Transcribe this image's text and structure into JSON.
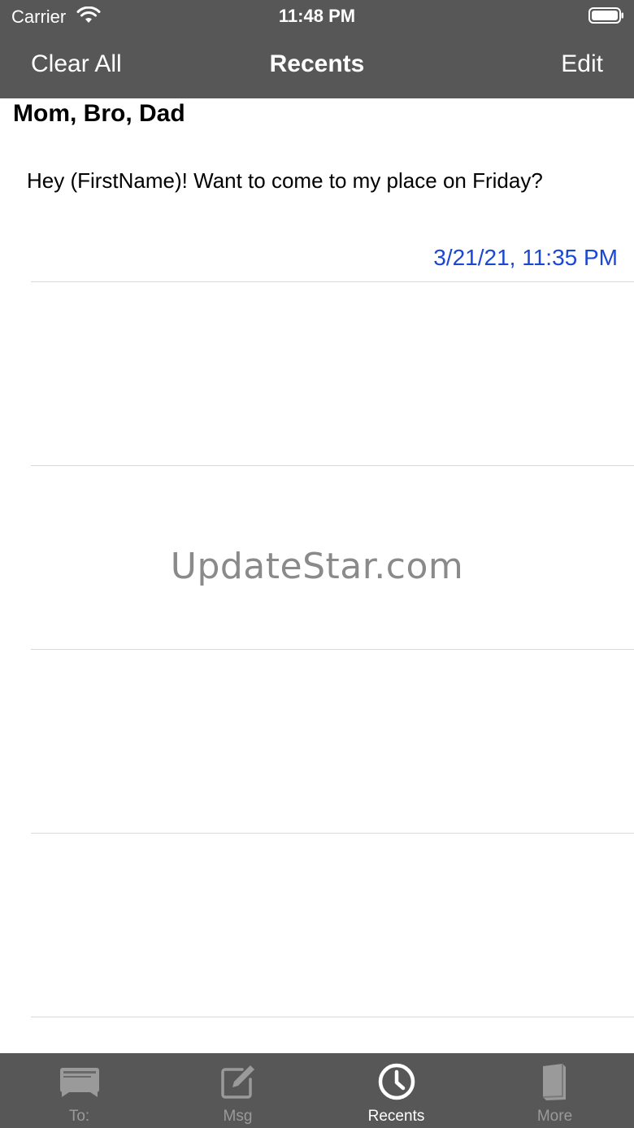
{
  "status_bar": {
    "carrier": "Carrier",
    "time": "11:48 PM"
  },
  "nav_bar": {
    "left_button": "Clear All",
    "title": "Recents",
    "right_button": "Edit"
  },
  "recents": [
    {
      "recipients": "Mom, Bro, Dad",
      "message": "Hey (FirstName)! Want to come to my place on Friday?",
      "timestamp": "3/21/21, 11:35 PM"
    }
  ],
  "watermark": "UpdateStar.com",
  "tab_bar": {
    "tabs": [
      {
        "label": "To:",
        "icon": "contacts-card-icon",
        "active": false
      },
      {
        "label": "Msg",
        "icon": "compose-icon",
        "active": false
      },
      {
        "label": "Recents",
        "icon": "clock-icon",
        "active": true
      },
      {
        "label": "More",
        "icon": "book-icon",
        "active": false
      }
    ]
  },
  "colors": {
    "bar_background": "#575757",
    "timestamp_blue": "#1a47d4",
    "inactive_tab": "#9a9a9a",
    "active_tab": "#ffffff"
  }
}
